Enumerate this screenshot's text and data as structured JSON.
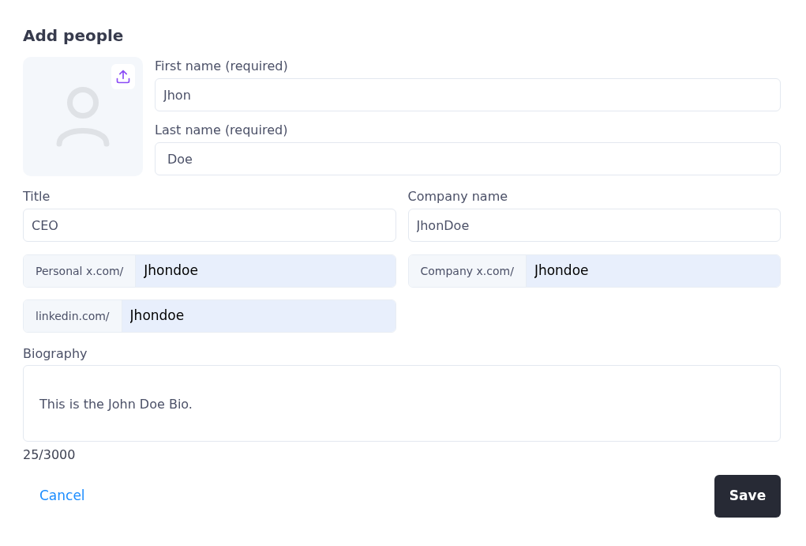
{
  "title": "Add people",
  "first_name": {
    "label": "First name (required)",
    "value": "Jhon"
  },
  "last_name": {
    "label": "Last name (required)",
    "value": "Doe"
  },
  "job_title": {
    "label": "Title",
    "value": "CEO"
  },
  "company_name": {
    "label": "Company name",
    "value": "JhonDoe"
  },
  "social_links": [
    {
      "prefix": "Personal x.com/",
      "value": "Jhondoe"
    },
    {
      "prefix": "Company x.com/",
      "value": "Jhondoe"
    },
    {
      "prefix": "linkedin.com/",
      "value": "Jhondoe"
    }
  ],
  "biography": {
    "label": "Biography",
    "value": "This is the John Doe Bio.",
    "counter": "25/3000"
  },
  "buttons": {
    "cancel": "Cancel",
    "save": "Save"
  }
}
